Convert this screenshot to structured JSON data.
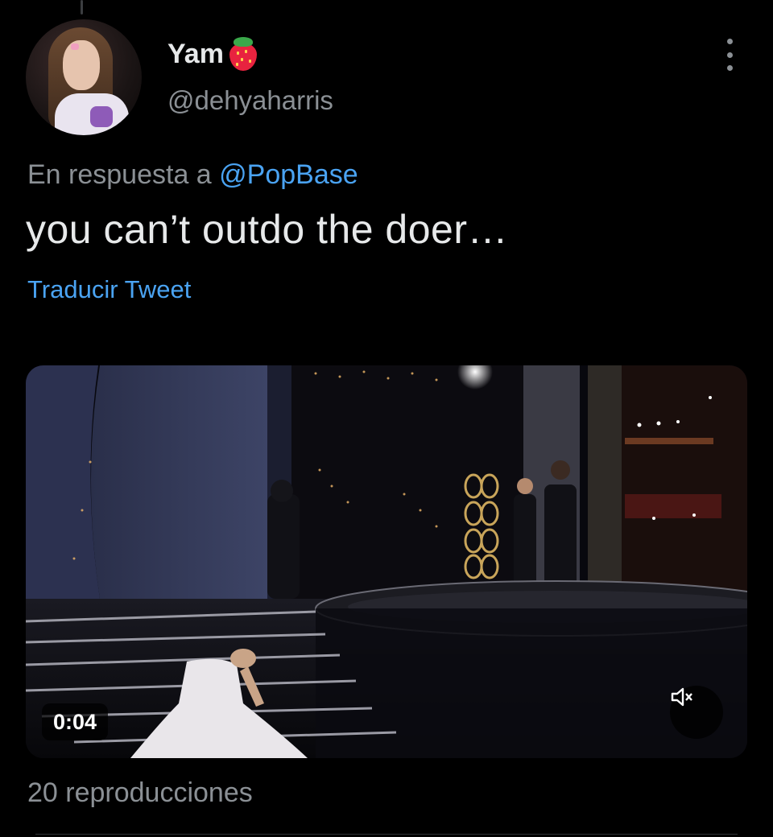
{
  "tweet": {
    "display_name": "Yam",
    "name_emoji": "strawberry",
    "handle": "@dehyaharris",
    "reply_prefix": "En respuesta a",
    "reply_mention": "@PopBase",
    "text": "you can’t outdo the doer…",
    "translate_label": "Traducir Tweet",
    "views_label": "20 reproducciones"
  },
  "video": {
    "duration": "0:04",
    "muted": true
  },
  "icons": {
    "more": "more-vertical-icon",
    "mute": "speaker-muted-icon"
  },
  "colors": {
    "background": "#000000",
    "text": "#e7e9ea",
    "secondary": "#8b9095",
    "link": "#4aa3f2"
  }
}
